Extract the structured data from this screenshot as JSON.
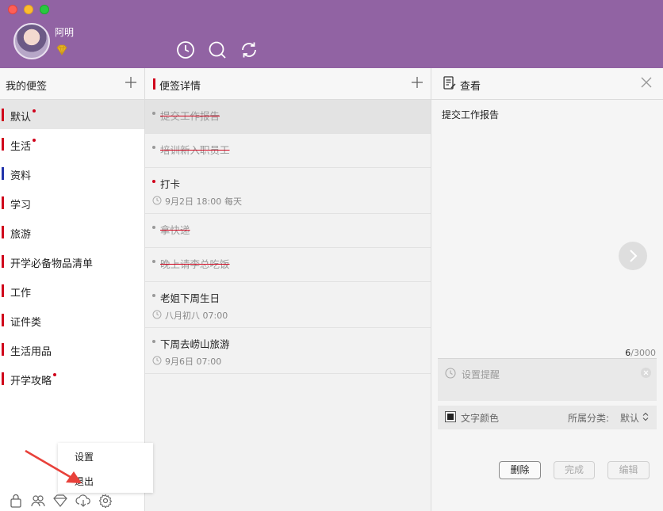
{
  "header": {
    "username": "阿明",
    "bg_color": "#9163a3",
    "icons": [
      "clock-icon",
      "search-icon",
      "sync-icon"
    ]
  },
  "categories_panel": {
    "title": "我的便签",
    "items": [
      {
        "label": "默认",
        "bar_color": "#d0021b",
        "unread": true,
        "active": true
      },
      {
        "label": "生活",
        "bar_color": "#d0021b",
        "unread": true
      },
      {
        "label": "资料",
        "bar_color": "#2233aa",
        "unread": false
      },
      {
        "label": "学习",
        "bar_color": "#d0021b",
        "unread": false
      },
      {
        "label": "旅游",
        "bar_color": "#d0021b",
        "unread": false
      },
      {
        "label": "开学必备物品清单",
        "bar_color": "#d0021b",
        "unread": false
      },
      {
        "label": "工作",
        "bar_color": "#d0021b",
        "unread": false
      },
      {
        "label": "证件类",
        "bar_color": "#d0021b",
        "unread": false
      },
      {
        "label": "生活用品",
        "bar_color": "#d0021b",
        "unread": false
      },
      {
        "label": "开学攻略",
        "bar_color": "#d0021b",
        "unread": true
      }
    ]
  },
  "notes_panel": {
    "title": "便签详情",
    "notes": [
      {
        "text": "提交工作报告",
        "done": true,
        "selected": true
      },
      {
        "text": "培训新入职员工",
        "done": true
      },
      {
        "text": "打卡",
        "done": false,
        "important": true,
        "time": "9月2日 18:00",
        "repeat": "每天"
      },
      {
        "text": "拿快递",
        "done": true
      },
      {
        "text": "晚上请李总吃饭",
        "done": true
      },
      {
        "text": "老姐下周生日",
        "done": false,
        "time": "八月初八 07:00"
      },
      {
        "text": "下周去崂山旅游",
        "done": false,
        "time": "9月6日 07:00"
      }
    ]
  },
  "detail_panel": {
    "title": "查看",
    "content": "提交工作报告",
    "char_count": "6",
    "char_limit": "/3000",
    "reminder_placeholder": "设置提醒",
    "text_color_label": "文字颜色",
    "category_label": "所属分类:",
    "category_value": "默认",
    "buttons": {
      "delete": "删除",
      "done": "完成",
      "edit": "编辑"
    }
  },
  "menu": {
    "items": [
      "设置",
      "退出"
    ]
  },
  "footer_icons": [
    "lock-icon",
    "friends-icon",
    "gem-icon",
    "cloud-download-icon",
    "gear-icon"
  ]
}
